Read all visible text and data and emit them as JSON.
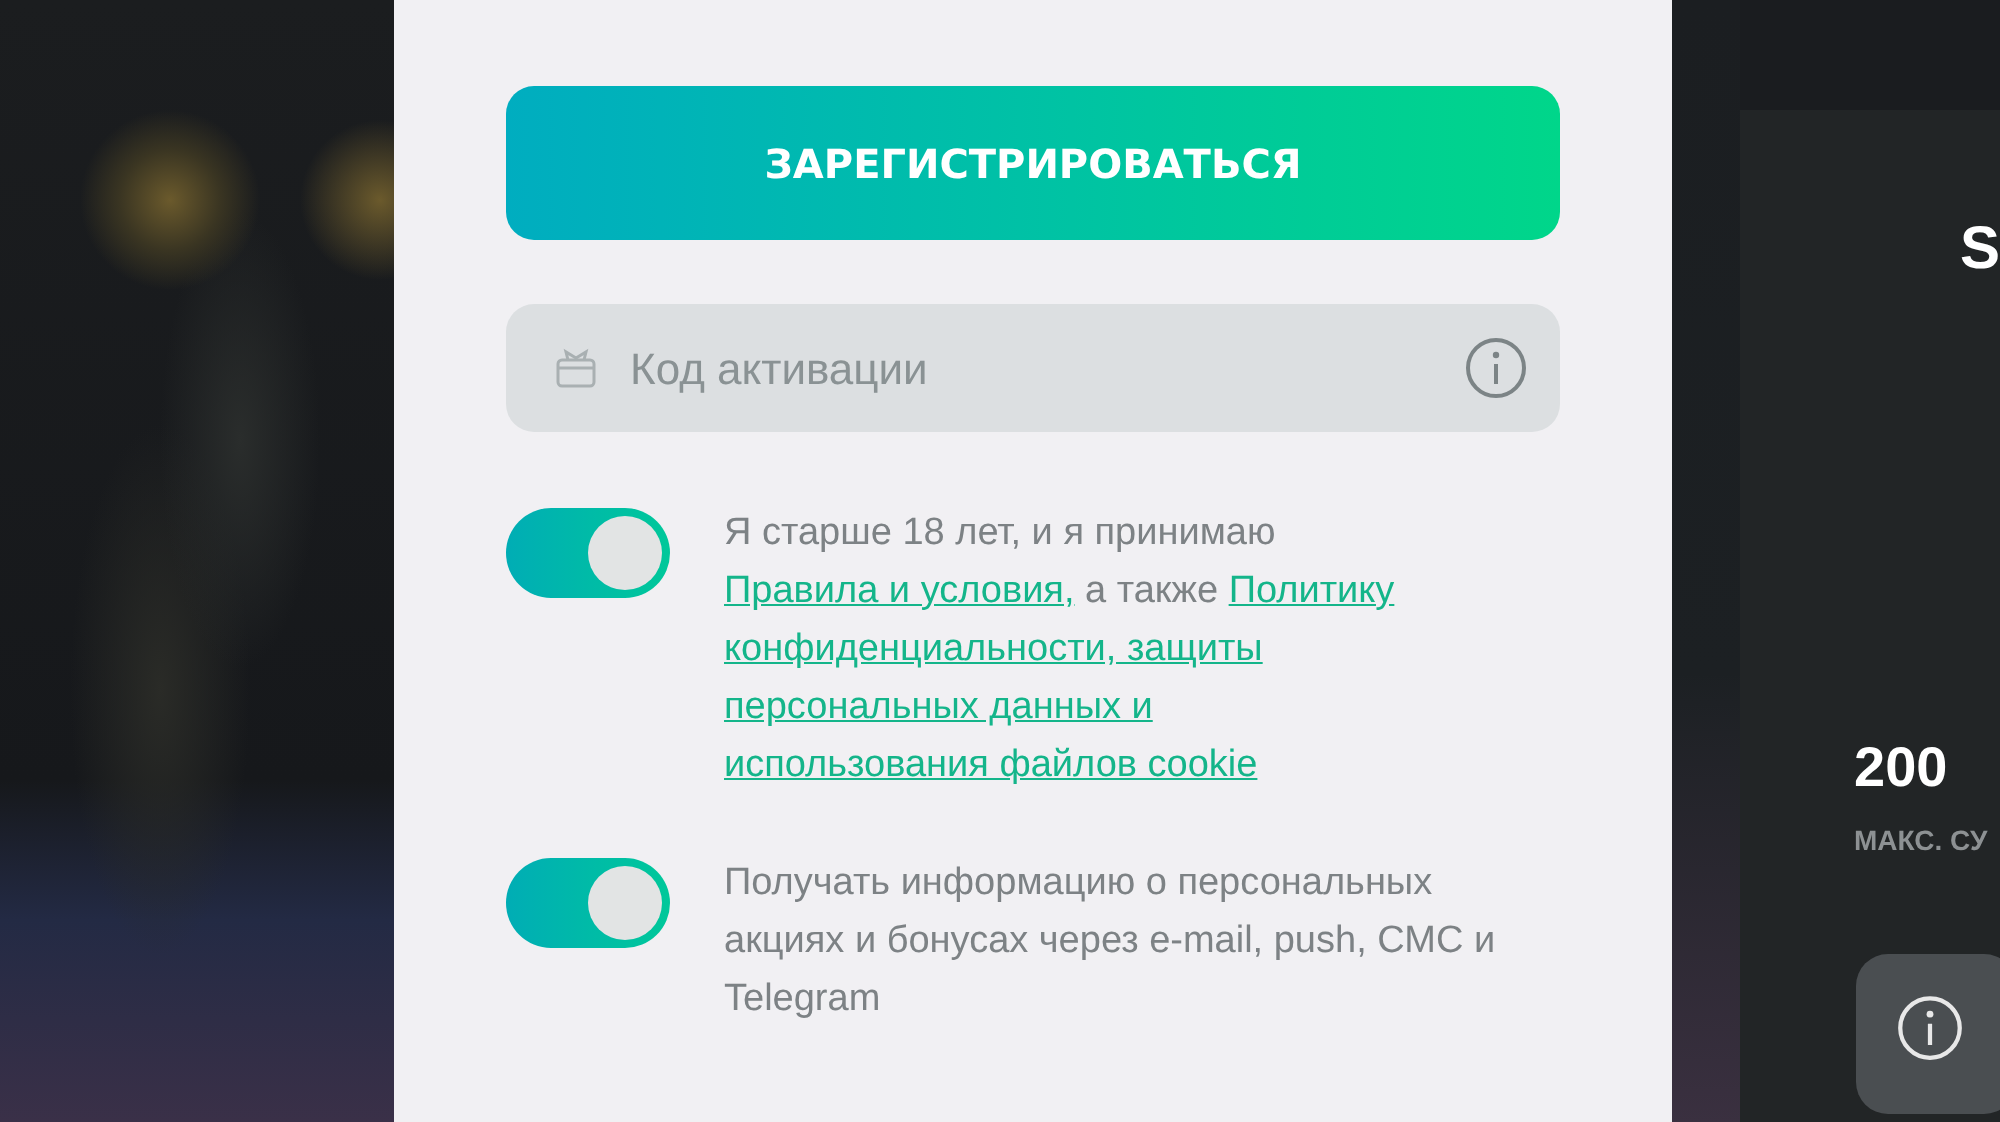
{
  "register_button": {
    "label": "ЗАРЕГИСТРИРОВАТЬСЯ"
  },
  "activation_field": {
    "placeholder": "Код активации"
  },
  "consents": [
    {
      "on": true,
      "parts": [
        {
          "kind": "text",
          "text": "Я старше 18 лет, и я принимаю"
        },
        {
          "kind": "link",
          "text": "Правила и условия,"
        },
        {
          "kind": "text",
          "text": "а также"
        },
        {
          "kind": "link",
          "text": "Политику"
        },
        {
          "kind": "link",
          "text": "конфиденциальности, защиты"
        },
        {
          "kind": "link",
          "text": "персональных данных и"
        },
        {
          "kind": "link",
          "text": "использования файлов cookie"
        }
      ]
    },
    {
      "on": true,
      "parts": [
        {
          "kind": "text",
          "text": "Получать информацию о персональных акциях и бонусах через e-mail, push, СМС и Telegram"
        }
      ]
    }
  ],
  "side_panel": {
    "title": "S",
    "amount": "200",
    "caption": "МАКС. СУ"
  }
}
